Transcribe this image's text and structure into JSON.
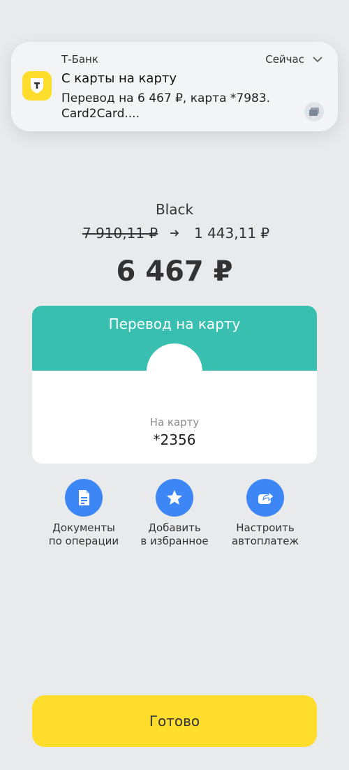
{
  "notification": {
    "app_name": "Т-Банк",
    "time": "Сейчас",
    "title": "С карты на карту",
    "body": "Перевод на 6 467 ₽, карта *7983. Card2Card...."
  },
  "card": {
    "name": "Black",
    "old_balance": "7 910,11 ₽",
    "new_balance": "1 443,11 ₽"
  },
  "amount": "6 467 ₽",
  "transfer": {
    "title": "Перевод на карту",
    "to_label": "На карту",
    "to_value": "*2356",
    "accent_color": "#38bfb0"
  },
  "actions": [
    {
      "icon": "document-icon",
      "line1": "Документы",
      "line2": "по операции"
    },
    {
      "icon": "star-icon",
      "line1": "Добавить",
      "line2": "в избранное"
    },
    {
      "icon": "autopay-icon",
      "line1": "Настроить",
      "line2": "автоплатеж"
    }
  ],
  "done_button": "Готово",
  "colors": {
    "background": "#e9eaec",
    "brand_yellow": "#ffdd2d",
    "action_blue": "#3d86f5"
  }
}
